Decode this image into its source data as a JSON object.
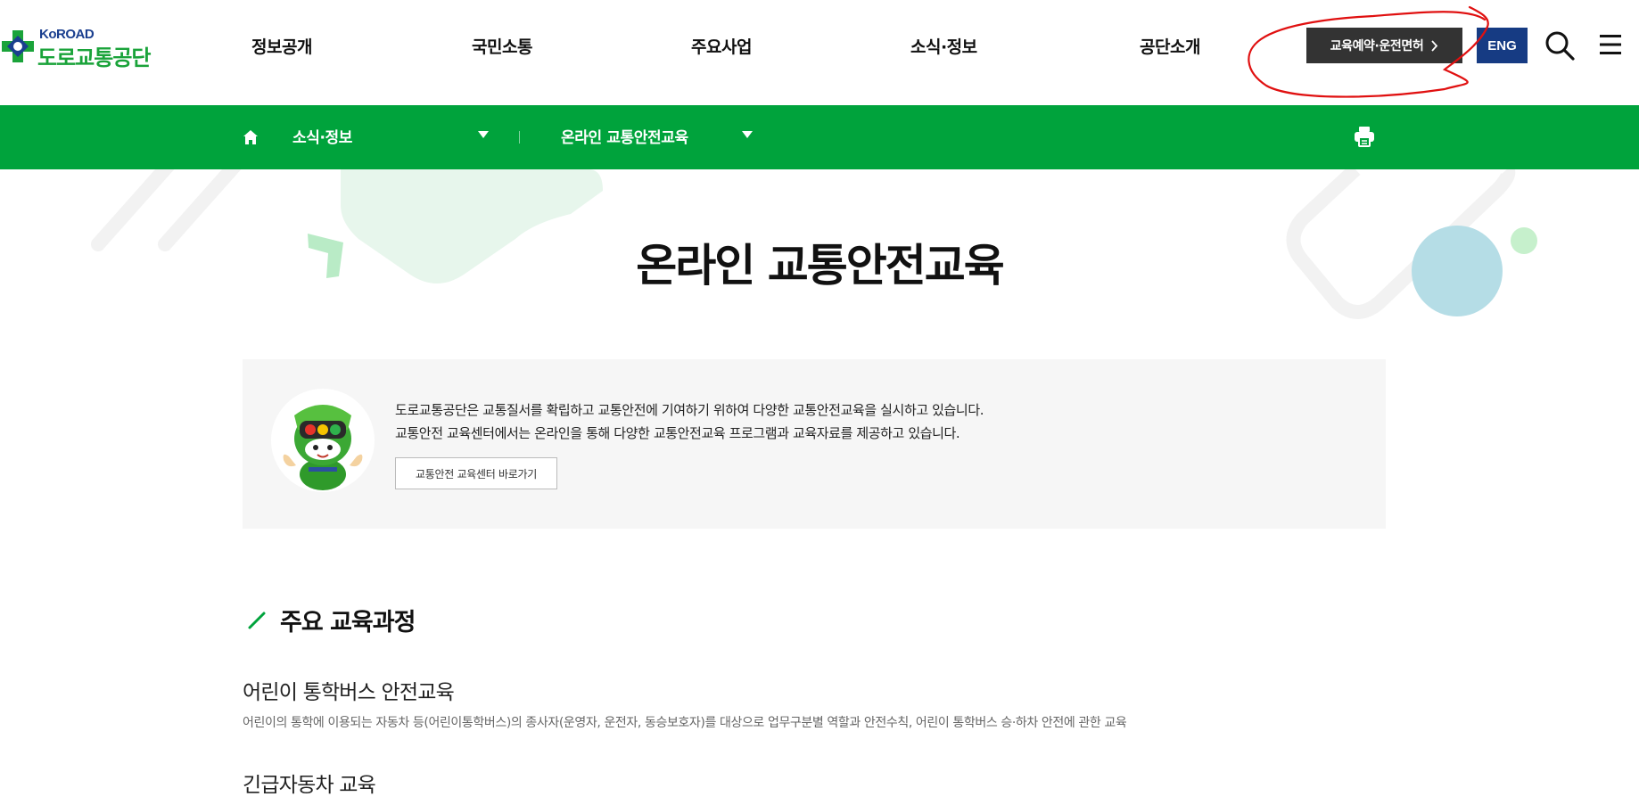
{
  "header": {
    "logo_en": "KoROAD",
    "logo_ko": "도로교통공단",
    "nav": [
      "정보공개",
      "국민소통",
      "주요사업",
      "소식·정보",
      "공단소개"
    ],
    "reserve_button": "교육예약·운전면허",
    "lang_button": "ENG",
    "search_icon": "search-icon",
    "menu_icon": "hamburger-menu-icon"
  },
  "location": {
    "level1": "소식·정보",
    "level2": "온라인 교통안전교육"
  },
  "page": {
    "title": "온라인 교통안전교육"
  },
  "intro": {
    "line1": "도로교통공단은 교통질서를 확립하고 교통안전에 기여하기 위하여 다양한 교통안전교육을 실시하고 있습니다.",
    "line2": "교통안전 교육센터에서는 온라인을 통해 다양한 교통안전교육 프로그램과 교육자료를 제공하고 있습니다.",
    "button": "교통안전 교육센터 바로가기"
  },
  "section": {
    "title": "주요 교육과정",
    "courses": [
      {
        "title": "어린이 통학버스 안전교육",
        "desc": "어린이의 통학에 이용되는 자동차 등(어린이통학버스)의 종사자(운영자, 운전자, 동승보호자)를 대상으로 업무구분별 역할과 안전수칙, 어린이 통학버스 승·하차 안전에 관한 교육"
      },
      {
        "title": "긴급자동차 교육"
      }
    ]
  },
  "colors": {
    "brand_green": "#00a33c",
    "brand_navy": "#163b83",
    "annotation_red": "#e01010"
  }
}
